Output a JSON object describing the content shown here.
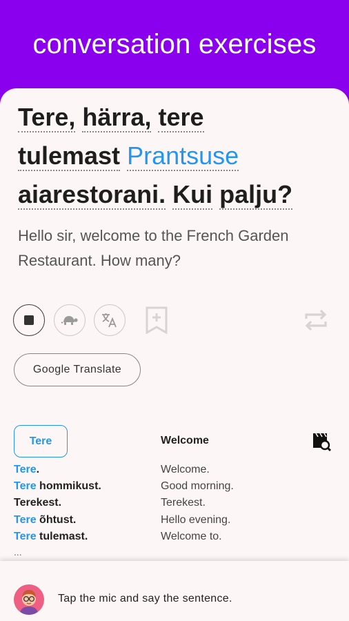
{
  "header": {
    "title": "conversation exercises"
  },
  "sentence": {
    "words_line1": [
      "Tere,",
      "härra,",
      "tere"
    ],
    "words_line2_plain": "tulemast",
    "words_line2_highlight": "Prantsuse",
    "words_line3": [
      "aiarestorani.",
      "Kui",
      "palju?"
    ],
    "translation": "Hello sir, welcome to the French Garden Restaurant. How many?"
  },
  "controls": {
    "stop_icon": "stop-icon",
    "slow_icon": "turtle-icon",
    "translate_icon": "translate-icon",
    "bookmark_icon": "bookmark-add-icon",
    "repeat_icon": "repeat-icon"
  },
  "google_translate_label": "Google Translate",
  "word": {
    "term": "Tere",
    "meaning": "Welcome",
    "examples": [
      {
        "highlight": "Tere",
        "rest": ".",
        "translation": "Welcome."
      },
      {
        "highlight": "Tere",
        "rest": " hommikust.",
        "translation": "Good morning."
      },
      {
        "highlight": "",
        "rest": "Terekest.",
        "translation": "Terekest."
      },
      {
        "highlight": "Tere",
        "rest": " õhtust.",
        "translation": "Hello evening."
      },
      {
        "highlight": "Tere",
        "rest": " tulemast.",
        "translation": "Welcome to."
      }
    ],
    "more": "..."
  },
  "bottom": {
    "prompt": "Tap the mic and say the sentence."
  },
  "colors": {
    "brand": "#8a00ee",
    "highlight": "#2296f3",
    "card": "#fdf6f6"
  }
}
